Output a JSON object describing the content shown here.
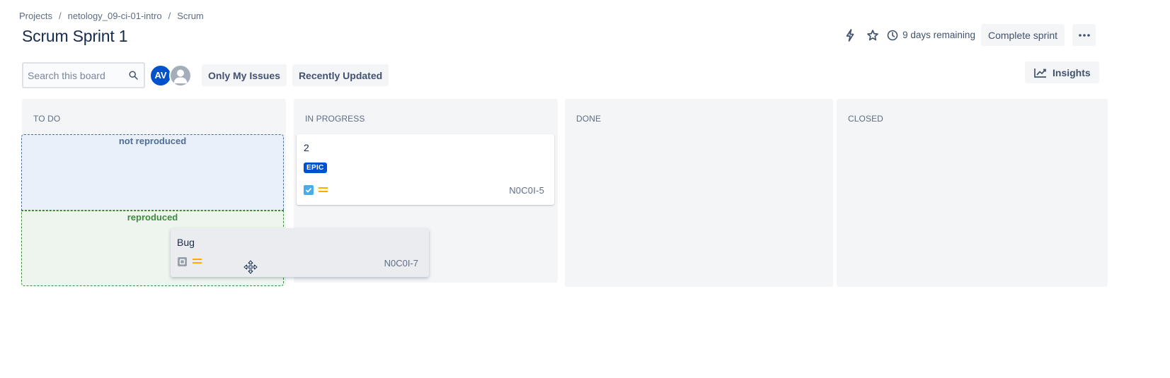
{
  "breadcrumb": {
    "items": [
      "Projects",
      "netology_09-ci-01-intro",
      "Scrum"
    ],
    "separator": "/"
  },
  "page": {
    "title": "Scrum Sprint 1"
  },
  "header": {
    "remaining": "9 days remaining",
    "complete_sprint": "Complete sprint"
  },
  "toolbar": {
    "search_placeholder": "Search this board",
    "avatar_initials": "AV",
    "filters": [
      "Only My Issues",
      "Recently Updated"
    ],
    "insights": "Insights"
  },
  "columns": [
    "TO DO",
    "IN PROGRESS",
    "DONE",
    "CLOSED"
  ],
  "drop_zones": {
    "not_reproduced": "not reproduced",
    "reproduced": "reproduced"
  },
  "cards": [
    {
      "summary": "2",
      "badge": "EPIC",
      "type_icon": "task-checkbox-icon",
      "priority_icon": "priority-medium-icon",
      "key": "N0C0I-5"
    }
  ],
  "dragging_card": {
    "summary": "Bug",
    "type_icon": "subtask-icon",
    "priority_icon": "priority-medium-icon",
    "key": "N0C0I-7"
  },
  "colors": {
    "accent": "#0052cc",
    "priority": "#ffab00",
    "not_reproduced": "#4f6e97",
    "reproduced": "#3d8b3d",
    "column_bg": "#f4f5f7"
  }
}
